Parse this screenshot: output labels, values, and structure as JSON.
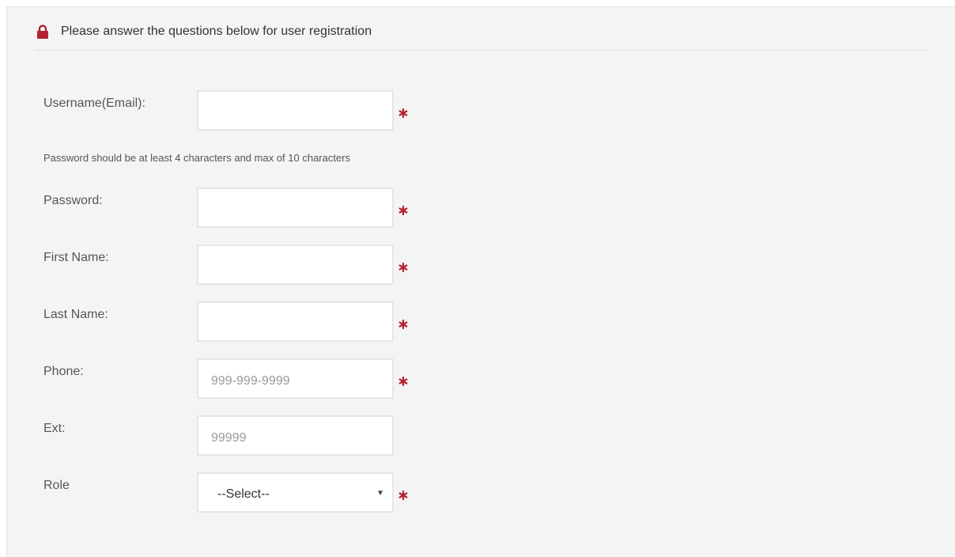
{
  "header": {
    "icon": "lock-icon",
    "text": "Please answer the questions below for user registration"
  },
  "colors": {
    "accent": "#b5202e",
    "panel": "#f4f4f4",
    "label": "#555555"
  },
  "form": {
    "username": {
      "label": "Username(Email):",
      "value": "",
      "placeholder": ""
    },
    "password_hint": "Password should be at least 4 characters and max of 10 characters",
    "password": {
      "label": "Password:",
      "value": "",
      "placeholder": ""
    },
    "first_name": {
      "label": "First Name:",
      "value": "",
      "placeholder": ""
    },
    "last_name": {
      "label": "Last Name:",
      "value": "",
      "placeholder": ""
    },
    "phone": {
      "label": "Phone:",
      "value": "",
      "placeholder": "999-999-9999"
    },
    "ext": {
      "label": "Ext:",
      "value": "",
      "placeholder": "99999"
    },
    "role": {
      "label": "Role",
      "selected": "--Select--"
    }
  }
}
